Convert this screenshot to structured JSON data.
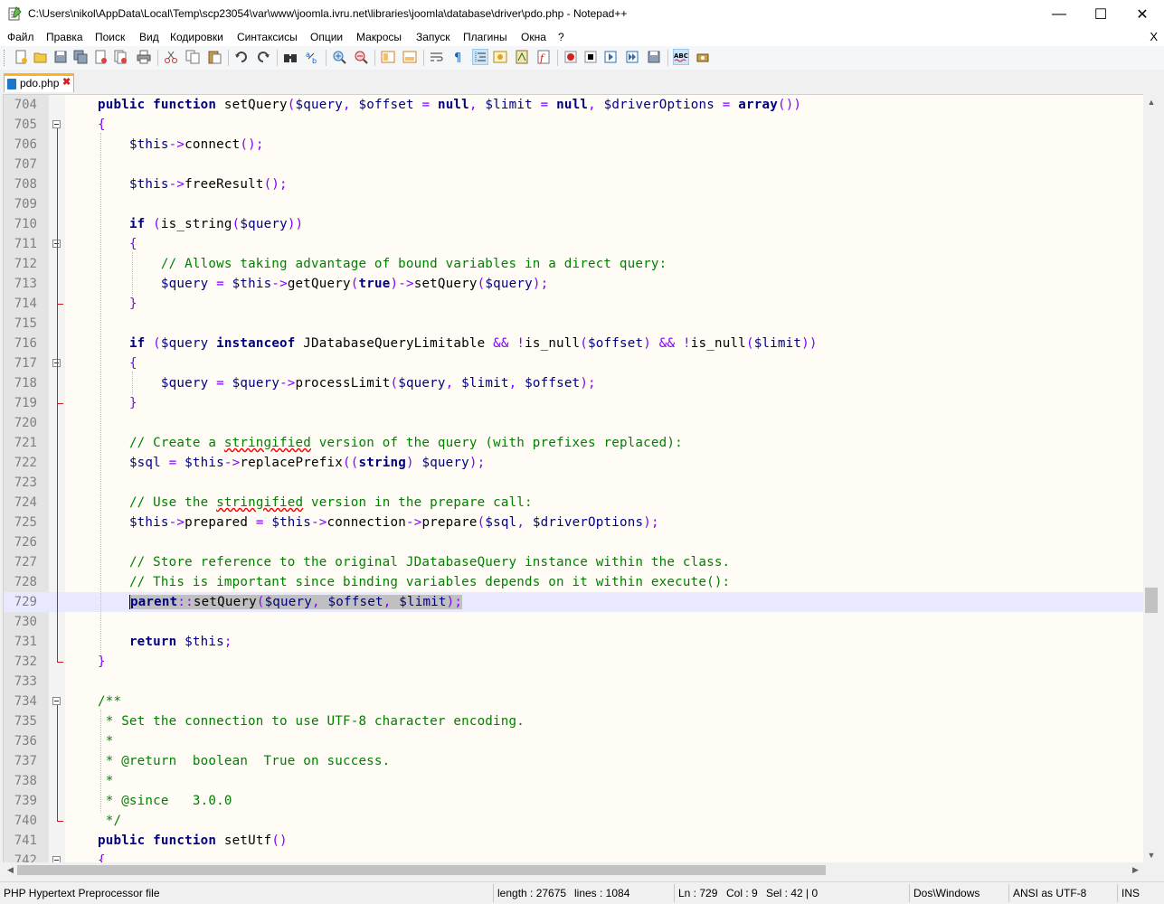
{
  "window": {
    "title": "C:\\Users\\nikol\\AppData\\Local\\Temp\\scp23054\\var\\www\\joomla.ivru.net\\libraries\\joomla\\database\\driver\\pdo.php - Notepad++",
    "minimize": "—",
    "maximize": "☐",
    "close": "✕"
  },
  "menu": {
    "items": [
      "Файл",
      "Правка",
      "Поиск",
      "Вид",
      "Кодировки",
      "Синтаксисы",
      "Опции",
      "Макросы",
      "Запуск",
      "Плагины",
      "Окна",
      "?"
    ],
    "close": "X"
  },
  "tab": {
    "label": "pdo.php",
    "close": "✖"
  },
  "editor": {
    "lines": [
      {
        "n": "704",
        "text": "    public function setQuery($query, $offset = null, $limit = null, $driverOptions = array())"
      },
      {
        "n": "705",
        "text": "    {"
      },
      {
        "n": "706",
        "text": "        $this->connect();"
      },
      {
        "n": "707",
        "text": ""
      },
      {
        "n": "708",
        "text": "        $this->freeResult();"
      },
      {
        "n": "709",
        "text": ""
      },
      {
        "n": "710",
        "text": "        if (is_string($query))"
      },
      {
        "n": "711",
        "text": "        {"
      },
      {
        "n": "712",
        "text": "            // Allows taking advantage of bound variables in a direct query:"
      },
      {
        "n": "713",
        "text": "            $query = $this->getQuery(true)->setQuery($query);"
      },
      {
        "n": "714",
        "text": "        }"
      },
      {
        "n": "715",
        "text": ""
      },
      {
        "n": "716",
        "text": "        if ($query instanceof JDatabaseQueryLimitable && !is_null($offset) && !is_null($limit))"
      },
      {
        "n": "717",
        "text": "        {"
      },
      {
        "n": "718",
        "text": "            $query = $query->processLimit($query, $limit, $offset);"
      },
      {
        "n": "719",
        "text": "        }"
      },
      {
        "n": "720",
        "text": ""
      },
      {
        "n": "721",
        "text": "        // Create a stringified version of the query (with prefixes replaced):"
      },
      {
        "n": "722",
        "text": "        $sql = $this->replacePrefix((string) $query);"
      },
      {
        "n": "723",
        "text": ""
      },
      {
        "n": "724",
        "text": "        // Use the stringified version in the prepare call:"
      },
      {
        "n": "725",
        "text": "        $this->prepared = $this->connection->prepare($sql, $driverOptions);"
      },
      {
        "n": "726",
        "text": ""
      },
      {
        "n": "727",
        "text": "        // Store reference to the original JDatabaseQuery instance within the class."
      },
      {
        "n": "728",
        "text": "        // This is important since binding variables depends on it within execute():"
      },
      {
        "n": "729",
        "text": "        parent::setQuery($query, $offset, $limit);"
      },
      {
        "n": "730",
        "text": ""
      },
      {
        "n": "731",
        "text": "        return $this;"
      },
      {
        "n": "732",
        "text": "    }"
      },
      {
        "n": "733",
        "text": ""
      },
      {
        "n": "734",
        "text": "    /**"
      },
      {
        "n": "735",
        "text": "     * Set the connection to use UTF-8 character encoding."
      },
      {
        "n": "736",
        "text": "     *"
      },
      {
        "n": "737",
        "text": "     * @return  boolean  True on success."
      },
      {
        "n": "738",
        "text": "     *"
      },
      {
        "n": "739",
        "text": "     * @since   3.0.0"
      },
      {
        "n": "740",
        "text": "     */"
      },
      {
        "n": "741",
        "text": "    public function setUtf()"
      },
      {
        "n": "742",
        "text": "    {"
      }
    ],
    "current_line": "729"
  },
  "status": {
    "filetype": "PHP Hypertext Preprocessor file",
    "length": "length : 27675",
    "lines": "lines : 1084",
    "ln": "Ln : 729",
    "col": "Col : 9",
    "sel": "Sel : 42 | 0",
    "eol": "Dos\\Windows",
    "encoding": "ANSI as UTF-8",
    "mode": "INS"
  },
  "colors": {
    "keyword": "#000080",
    "comment": "#008000",
    "operator": "#8000ff",
    "current_line_bg": "#e8e8ff",
    "editor_bg": "#fefcf5",
    "fold_line": "#d81818",
    "tab_accent": "#fab41e"
  }
}
